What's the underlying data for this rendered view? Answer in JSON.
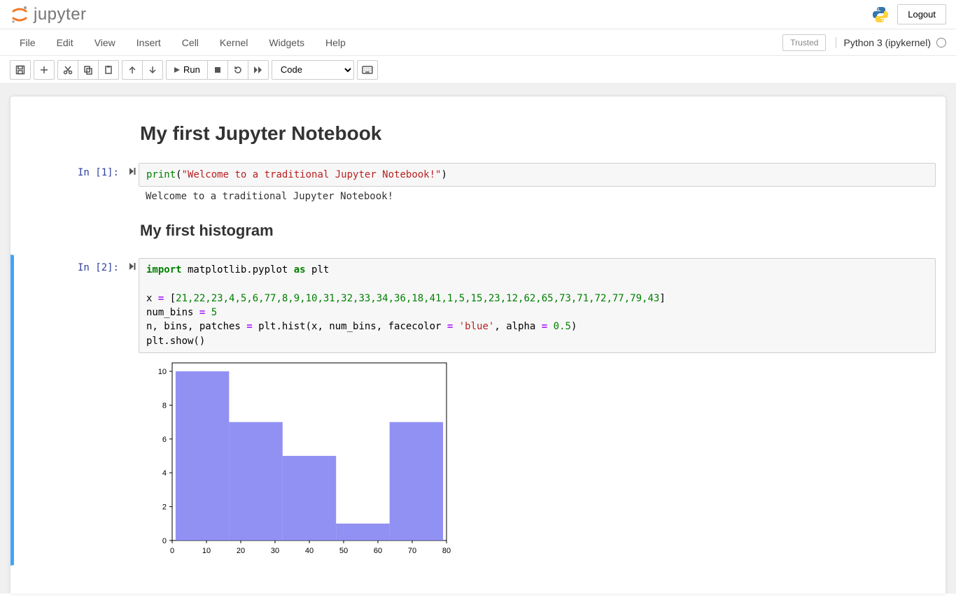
{
  "header": {
    "logo_text": "jupyter",
    "logout": "Logout"
  },
  "menubar": {
    "items": [
      "File",
      "Edit",
      "View",
      "Insert",
      "Cell",
      "Kernel",
      "Widgets",
      "Help"
    ],
    "trusted": "Trusted",
    "kernel": "Python 3 (ipykernel)"
  },
  "toolbar": {
    "run_label": "Run",
    "cell_type": "Code"
  },
  "cells": {
    "md1_title": "My first Jupyter Notebook",
    "c1_prompt": "In [1]:",
    "c1_code_builtin": "print",
    "c1_code_paren_open": "(",
    "c1_code_string": "\"Welcome to a traditional Jupyter Notebook!\"",
    "c1_code_paren_close": ")",
    "c1_output": "Welcome to a traditional Jupyter Notebook!",
    "md2_title": "My first histogram",
    "c2_prompt": "In [2]:",
    "c2_line1_import": "import",
    "c2_line1_mod": " matplotlib.pyplot ",
    "c2_line1_as": "as",
    "c2_line1_alias": " plt",
    "c2_blank": "",
    "c2_line3_x": "x ",
    "c2_line3_eq": "=",
    "c2_line3_rest": " [",
    "c2_line3_nums": "21,22,23,4,5,6,77,8,9,10,31,32,33,34,36,18,41,1,5,15,23,12,62,65,73,71,72,77,79,43",
    "c2_line3_close": "]",
    "c2_line4_var": "num_bins ",
    "c2_line4_eq": "=",
    "c2_line4_val": " 5",
    "c2_line5_pre": "n, bins, patches ",
    "c2_line5_eq": "=",
    "c2_line5_call": " plt.hist(x, num_bins, facecolor ",
    "c2_line5_eq2": "=",
    "c2_line5_str": " 'blue'",
    "c2_line5_mid": ", alpha ",
    "c2_line5_eq3": "=",
    "c2_line5_alpha": " 0.5",
    "c2_line5_end": ")",
    "c2_line6": "plt.show()"
  },
  "chart_data": {
    "type": "bar",
    "title": "",
    "xlabel": "",
    "ylabel": "",
    "x_ticks": [
      0,
      10,
      20,
      30,
      40,
      50,
      60,
      70,
      80
    ],
    "y_ticks": [
      0,
      2,
      4,
      6,
      8,
      10
    ],
    "xlim": [
      0,
      80
    ],
    "ylim": [
      0,
      10.5
    ],
    "bin_edges": [
      1,
      16.6,
      32.2,
      47.8,
      63.4,
      79
    ],
    "values": [
      10,
      7,
      5,
      1,
      7
    ],
    "facecolor": "#7e7ef2",
    "alpha": 0.85
  }
}
